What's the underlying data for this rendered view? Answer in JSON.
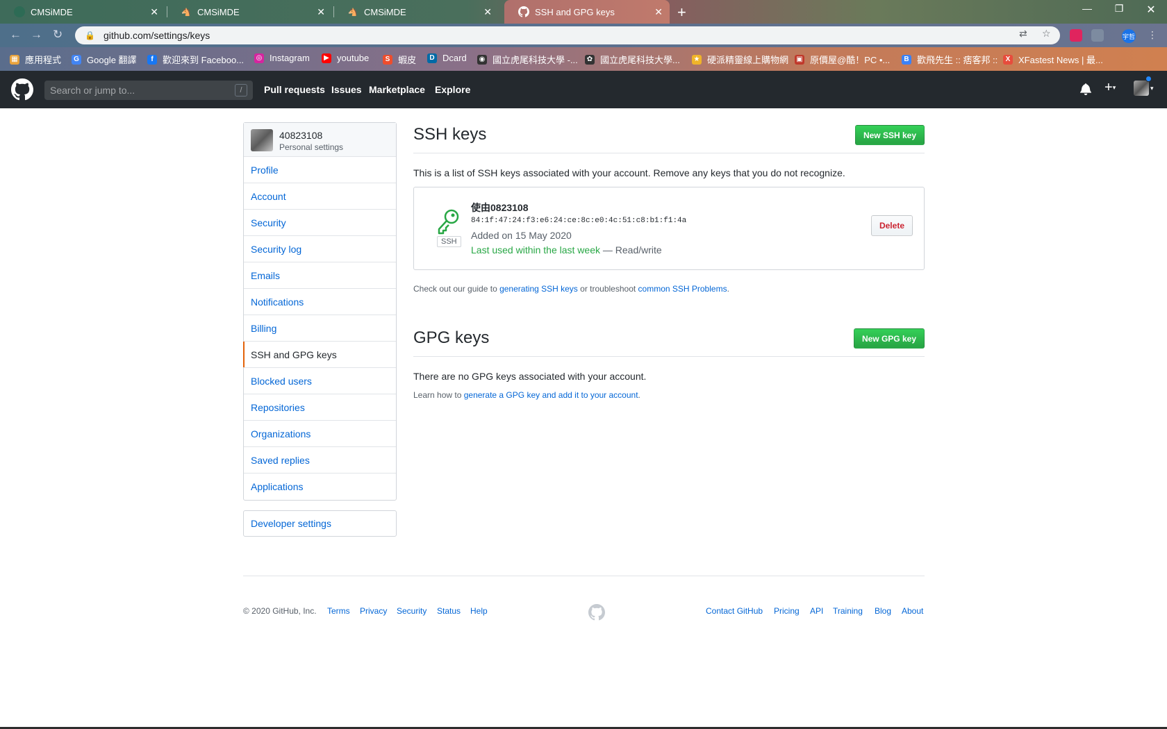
{
  "browser": {
    "tabs": [
      {
        "title": "CMSiMDE",
        "active": false
      },
      {
        "title": "CMSiMDE",
        "active": false
      },
      {
        "title": "CMSiMDE",
        "active": false
      },
      {
        "title": "SSH and GPG keys",
        "active": true
      }
    ],
    "url": "github.com/settings/keys",
    "profile_badge": "宇哲",
    "bookmarks": [
      {
        "label": "應用程式",
        "color": "#e8a33d"
      },
      {
        "label": "Google 翻譯",
        "color": "#4285f4"
      },
      {
        "label": "歡迎來到 Faceboo...",
        "color": "#1877f2"
      },
      {
        "label": "Instagram",
        "color": "#d6249f"
      },
      {
        "label": "youtube",
        "color": "#ff0000"
      },
      {
        "label": "蝦皮",
        "color": "#ee4d2d"
      },
      {
        "label": "Dcard",
        "color": "#006aa6"
      },
      {
        "label": "國立虎尾科技大學 -...",
        "color": "#333333"
      },
      {
        "label": "國立虎尾科技大學...",
        "color": "#333333"
      },
      {
        "label": "硬派精靈線上購物網",
        "color": "#f0b429"
      },
      {
        "label": "原價屋@酷！PC •...",
        "color": "#c0392b"
      },
      {
        "label": "歡飛先生 :: 痞客邦 ::",
        "color": "#3b82f6"
      },
      {
        "label": "XFastest News | 最...",
        "color": "#e74c3c"
      }
    ]
  },
  "header": {
    "search_placeholder": "Search or jump to...",
    "search_shortcut": "/",
    "nav": [
      "Pull requests",
      "Issues",
      "Marketplace",
      "Explore"
    ]
  },
  "sidebar": {
    "username": "40823108",
    "subtitle": "Personal settings",
    "items": [
      "Profile",
      "Account",
      "Security",
      "Security log",
      "Emails",
      "Notifications",
      "Billing",
      "SSH and GPG keys",
      "Blocked users",
      "Repositories",
      "Organizations",
      "Saved replies",
      "Applications"
    ],
    "selected": "SSH and GPG keys",
    "developer": "Developer settings"
  },
  "ssh": {
    "title": "SSH keys",
    "button": "New SSH key",
    "description": "This is a list of SSH keys associated with your account. Remove any keys that you do not recognize.",
    "key": {
      "badge": "SSH",
      "title": "使由0823108",
      "fingerprint": "84:1f:47:24:f3:e6:24:ce:8c:e0:4c:51:c8:b1:f1:4a",
      "added": "Added on 15 May 2020",
      "last_used": "Last used within the last week",
      "access": " — Read/write",
      "delete_label": "Delete"
    },
    "guide_prefix": "Check out our guide to ",
    "guide_link1": "generating SSH keys",
    "guide_mid": " or troubleshoot ",
    "guide_link2": "common SSH Problems",
    "guide_suffix": "."
  },
  "gpg": {
    "title": "GPG keys",
    "button": "New GPG key",
    "empty": "There are no GPG keys associated with your account.",
    "learn_prefix": "Learn how to ",
    "learn_link": "generate a GPG key and add it to your account",
    "learn_suffix": "."
  },
  "footer": {
    "copyright": "© 2020 GitHub, Inc.",
    "left_links": [
      "Terms",
      "Privacy",
      "Security",
      "Status",
      "Help"
    ],
    "right_links": [
      "Contact GitHub",
      "Pricing",
      "API",
      "Training",
      "Blog",
      "About"
    ]
  }
}
